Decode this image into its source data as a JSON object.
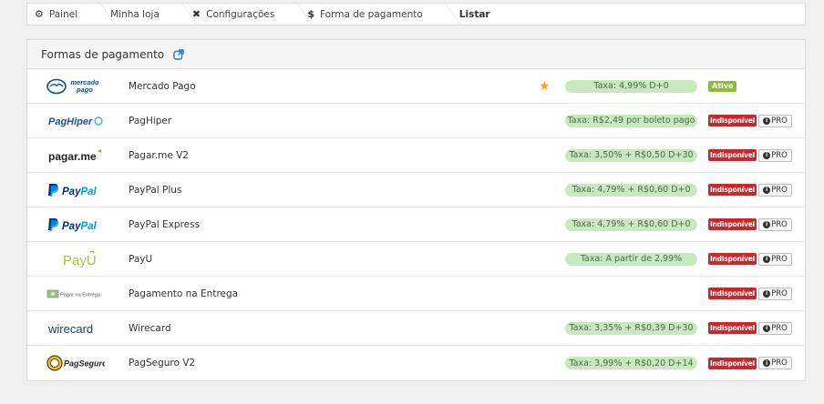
{
  "breadcrumb": [
    {
      "icon": "gear-icon",
      "label": "Painel"
    },
    {
      "icon": "",
      "label": "Minha loja"
    },
    {
      "icon": "wrench-icon",
      "label": "Configurações"
    },
    {
      "icon": "dollar-icon",
      "label": "Forma de pagamento"
    },
    {
      "icon": "",
      "label": "Listar"
    }
  ],
  "panel": {
    "title": "Formas de pagamento",
    "title_icon": "external-link-icon"
  },
  "methods": [
    {
      "logo_text": "mercado pago",
      "name": "Mercado Pago",
      "featured": true,
      "fee": "Taxa: 4,99% D+0",
      "status": "Ativo",
      "pro": ""
    },
    {
      "logo_text": "PagHiper",
      "name": "PagHiper",
      "featured": false,
      "fee": "Taxa: R$2,49 por boleto pago",
      "status": "Indisponível",
      "pro": "PRO"
    },
    {
      "logo_text": "pagar.me",
      "name": "Pagar.me V2",
      "featured": false,
      "fee": "Taxa: 3,50% + R$0,50 D+30",
      "status": "Indisponível",
      "pro": "PRO"
    },
    {
      "logo_text": "PayPal",
      "name": "PayPal Plus",
      "featured": false,
      "fee": "Taxa: 4,79% + R$0,60 D+0",
      "status": "Indisponível",
      "pro": "PRO"
    },
    {
      "logo_text": "PayPal",
      "name": "PayPal Express",
      "featured": false,
      "fee": "Taxa: 4,79% + R$0,60 D+0",
      "status": "Indisponível",
      "pro": "PRO"
    },
    {
      "logo_text": "PayU",
      "name": "PayU",
      "featured": false,
      "fee": "Taxa: A partir de 2,99%",
      "status": "Indisponível",
      "pro": "PRO"
    },
    {
      "logo_text": "Pagar na Entrega",
      "name": "Pagamento na Entrega",
      "featured": false,
      "fee": "",
      "status": "Indisponível",
      "pro": "PRO"
    },
    {
      "logo_text": "wirecard",
      "name": "Wirecard",
      "featured": false,
      "fee": "Taxa: 3,35% + R$0,39 D+30",
      "status": "Indisponível",
      "pro": "PRO"
    },
    {
      "logo_text": "PagSeguro",
      "name": "PagSeguro V2",
      "featured": false,
      "fee": "Taxa: 3,99% + R$0,20 D+14",
      "status": "Indisponível",
      "pro": "PRO"
    }
  ],
  "colors": {
    "fee_bg": "#c8e8c0",
    "active": "#8bbd3c",
    "unavailable": "#c8272b",
    "star": "#f5a623"
  }
}
